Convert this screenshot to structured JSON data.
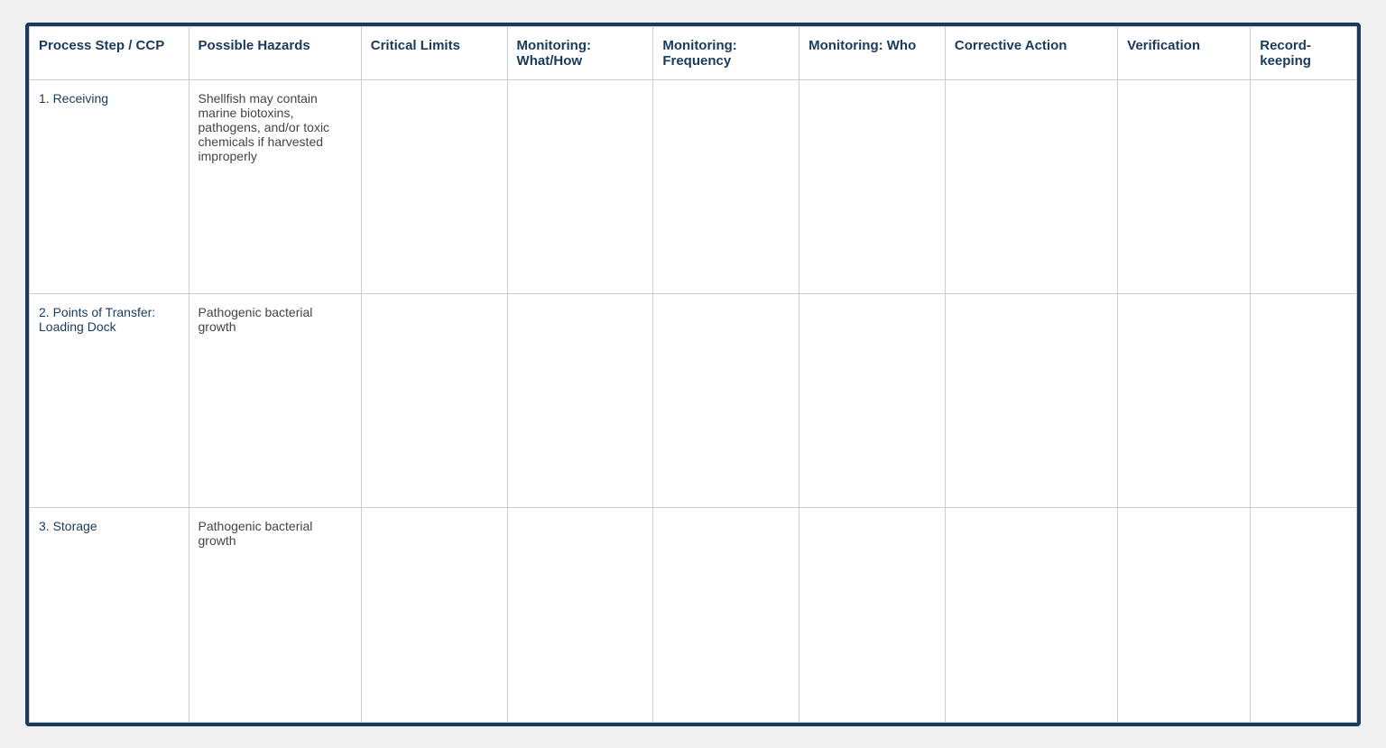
{
  "table": {
    "headers": [
      {
        "id": "process",
        "label": "Process Step / CCP"
      },
      {
        "id": "hazards",
        "label": "Possible Hazards"
      },
      {
        "id": "critical",
        "label": "Critical Limits"
      },
      {
        "id": "mon_what",
        "label": "Monitoring: What/How"
      },
      {
        "id": "mon_freq",
        "label": "Monitoring: Frequency"
      },
      {
        "id": "mon_who",
        "label": "Monitoring: Who"
      },
      {
        "id": "corrective",
        "label": "Corrective Action"
      },
      {
        "id": "verification",
        "label": "Verification"
      },
      {
        "id": "recordkeeping",
        "label": "Record-keeping"
      }
    ],
    "rows": [
      {
        "process": "1.    Receiving",
        "hazards": "Shellfish may contain marine biotoxins, pathogens, and/or toxic chemicals if harvested improperly",
        "critical": "",
        "mon_what": "",
        "mon_freq": "",
        "mon_who": "",
        "corrective": "",
        "verification": "",
        "recordkeeping": ""
      },
      {
        "process": "2.    Points of Transfer: Loading Dock",
        "hazards": "Pathogenic bacterial growth",
        "critical": "",
        "mon_what": "",
        "mon_freq": "",
        "mon_who": "",
        "corrective": "",
        "verification": "",
        "recordkeeping": ""
      },
      {
        "process": "3.    Storage",
        "hazards": "Pathogenic bacterial growth",
        "critical": "",
        "mon_what": "",
        "mon_freq": "",
        "mon_who": "",
        "corrective": "",
        "verification": "",
        "recordkeeping": ""
      }
    ]
  }
}
